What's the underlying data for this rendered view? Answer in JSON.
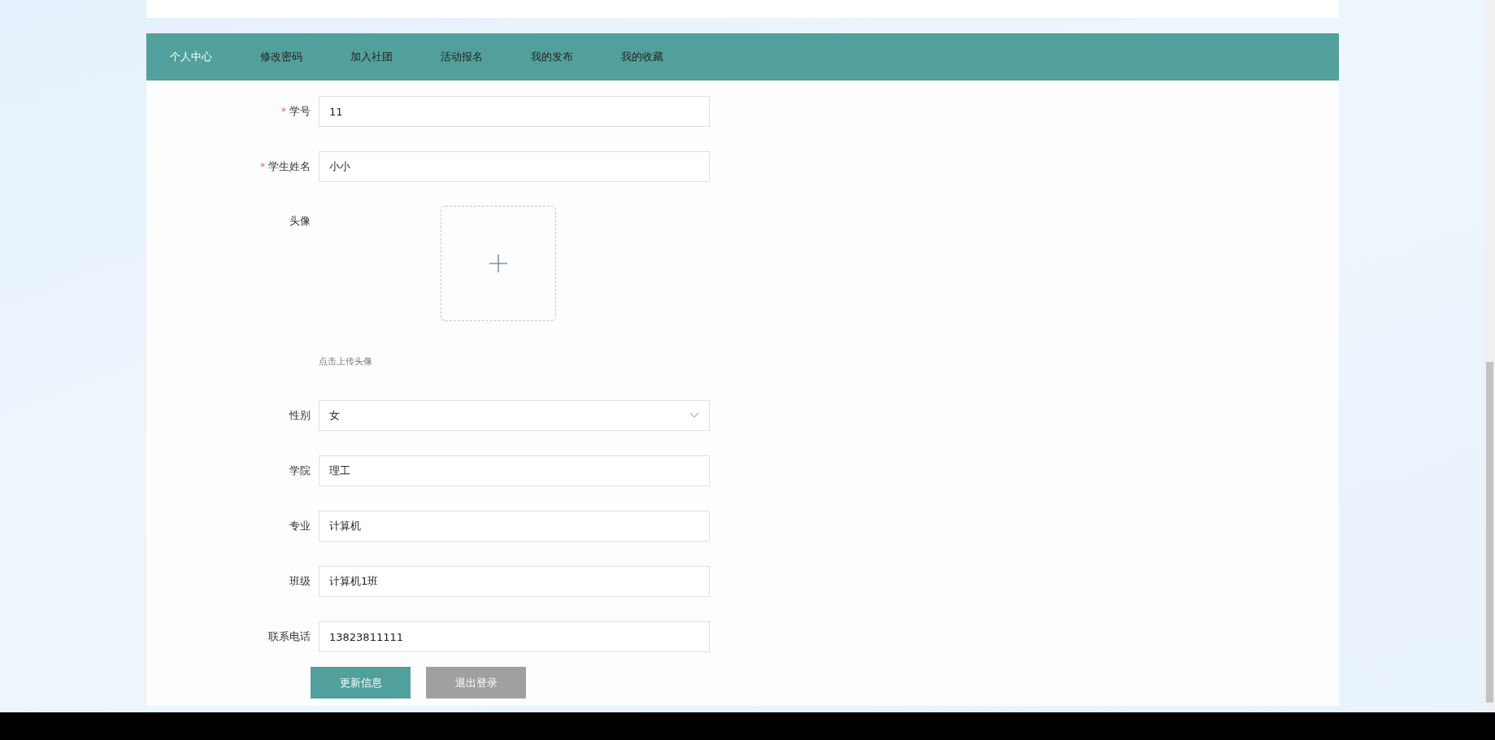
{
  "nav": [
    {
      "label": "个人中心",
      "selected": true
    },
    {
      "label": "修改密码",
      "selected": false
    },
    {
      "label": "加入社团",
      "selected": false
    },
    {
      "label": "活动报名",
      "selected": false
    },
    {
      "label": "我的发布",
      "selected": false
    },
    {
      "label": "我的收藏",
      "selected": false
    }
  ],
  "form": {
    "fields": [
      {
        "kind": "text",
        "label": "学号",
        "required_mark": "*",
        "value": "11"
      },
      {
        "kind": "text",
        "label": "学生姓名",
        "required_mark": "*",
        "value": "小小"
      },
      {
        "kind": "upload",
        "label": "头像",
        "hint": "点击上传头像"
      },
      {
        "kind": "select",
        "label": "性别",
        "value": "女"
      },
      {
        "kind": "text",
        "label": "学院",
        "value": "理工"
      },
      {
        "kind": "text",
        "label": "专业",
        "value": "计算机"
      },
      {
        "kind": "text",
        "label": "班级",
        "value": "计算机1班"
      },
      {
        "kind": "text",
        "label": "联系电话",
        "value": "13823811111"
      }
    ],
    "buttons": [
      {
        "kind": "primary",
        "label": "更新信息"
      },
      {
        "kind": "secondary",
        "label": "退出登录"
      }
    ]
  }
}
